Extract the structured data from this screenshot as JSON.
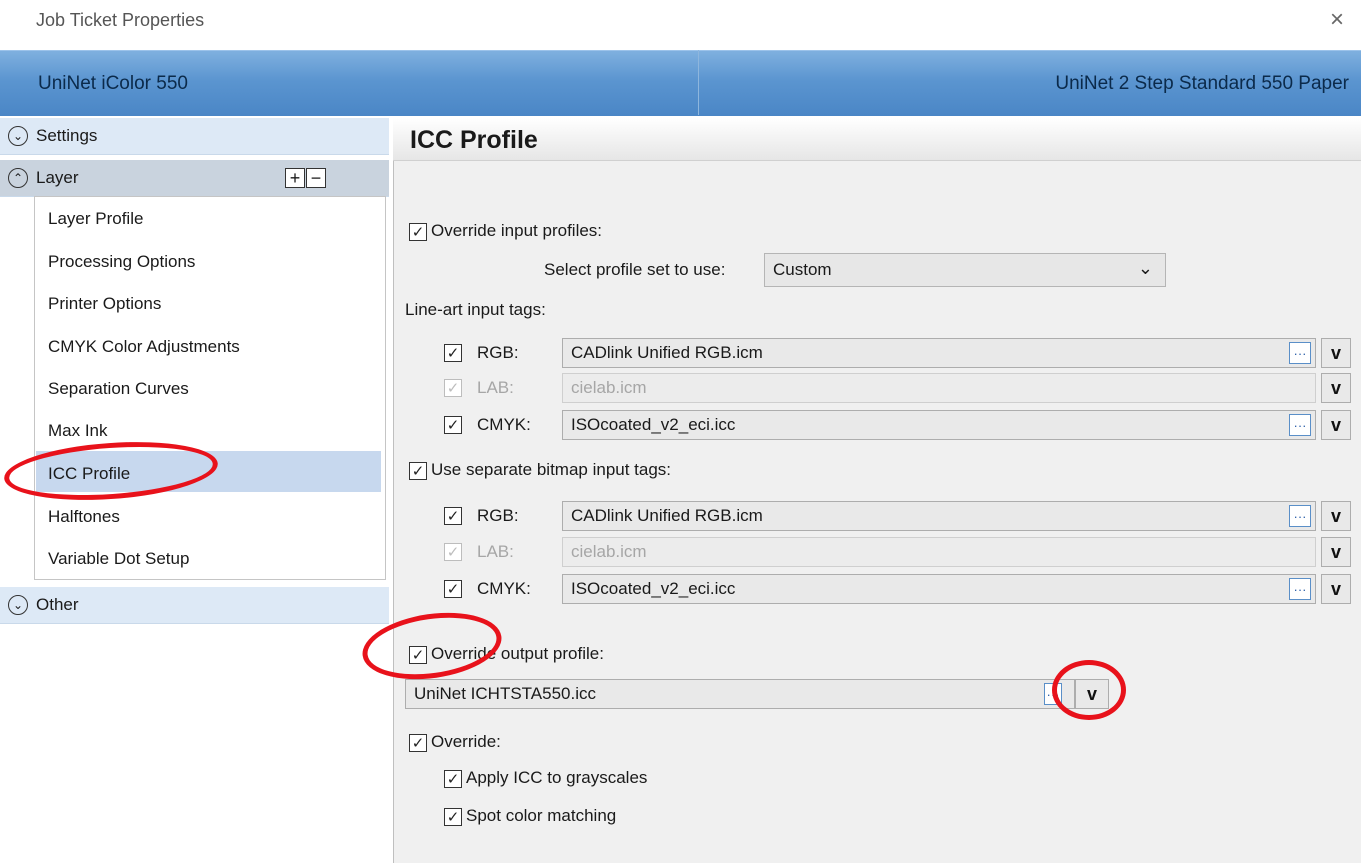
{
  "window": {
    "title": "Job Ticket Properties",
    "close_glyph": "×"
  },
  "header": {
    "printer": "UniNet iColor 550",
    "profile": "UniNet 2 Step Standard 550 Paper"
  },
  "nav": {
    "settings": {
      "label": "Settings",
      "icon": "chevron-down-circle-icon"
    },
    "layer": {
      "label": "Layer",
      "icon": "chevron-up-circle-icon",
      "add": "+",
      "remove": "−"
    },
    "items": [
      "Layer Profile",
      "Processing Options",
      "Printer Options",
      "CMYK Color Adjustments",
      "Separation Curves",
      "Max Ink",
      "ICC Profile",
      "Halftones",
      "Variable Dot Setup"
    ],
    "selected": "ICC Profile",
    "other": {
      "label": "Other",
      "icon": "chevron-down-circle-icon"
    }
  },
  "panel": {
    "title": "ICC Profile",
    "override_input": {
      "label": "Override input profiles:",
      "checked": true
    },
    "profile_set": {
      "label": "Select profile set to use:",
      "value": "Custom"
    },
    "lineart": {
      "label": "Line-art input tags:",
      "rows": [
        {
          "tag": "RGB:",
          "value": "CADlink Unified RGB.icm",
          "enabled": true
        },
        {
          "tag": "LAB:",
          "value": "cielab.icm",
          "enabled": false
        },
        {
          "tag": "CMYK:",
          "value": "ISOcoated_v2_eci.icc",
          "enabled": true
        }
      ]
    },
    "bitmap": {
      "label": "Use separate bitmap input tags:",
      "rows": [
        {
          "tag": "RGB:",
          "value": "CADlink Unified RGB.icm",
          "enabled": true
        },
        {
          "tag": "LAB:",
          "value": "cielab.icm",
          "enabled": false
        },
        {
          "tag": "CMYK:",
          "value": "ISOcoated_v2_eci.icc",
          "enabled": true
        }
      ]
    },
    "override_output": {
      "label": "Override output profile:",
      "value": "UniNet ICHTSTA550.icc"
    },
    "override": {
      "label": "Override:"
    },
    "apply_icc": {
      "label": "Apply ICC to grayscales"
    },
    "spot_color": {
      "label": "Spot color matching"
    },
    "glyphs": {
      "check": "✓",
      "dots": "···",
      "chevron": "v",
      "select_chevron": "⌄"
    }
  },
  "annotation_color": "#e8121b"
}
